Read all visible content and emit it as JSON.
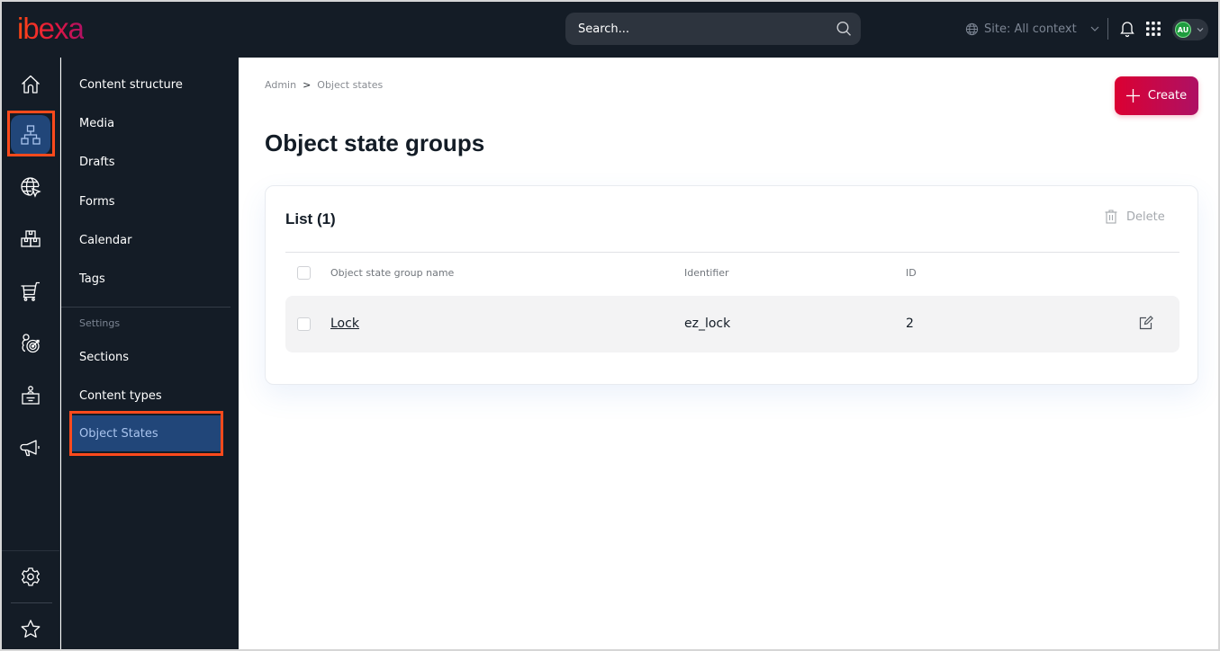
{
  "app": {
    "logo_text": "ibexa"
  },
  "topbar": {
    "search_placeholder": "Search...",
    "site_context_label": "Site: All context",
    "user_initials": "AU"
  },
  "rail": {
    "items": [
      {
        "id": "dashboard",
        "icon": "home-icon",
        "active": false
      },
      {
        "id": "content",
        "icon": "sitemap-icon",
        "active": true
      },
      {
        "id": "site",
        "icon": "globe-cursor-icon",
        "active": false
      },
      {
        "id": "product-catalog",
        "icon": "boxes-icon",
        "active": false
      },
      {
        "id": "commerce",
        "icon": "cart-icon",
        "active": false
      },
      {
        "id": "personalization",
        "icon": "user-target-icon",
        "active": false
      },
      {
        "id": "customer-portal",
        "icon": "badge-icon",
        "active": false
      },
      {
        "id": "marketing",
        "icon": "megaphone-icon",
        "active": false
      }
    ],
    "bottom_items": [
      {
        "id": "admin",
        "icon": "gear-icon"
      },
      {
        "id": "bookmarks",
        "icon": "star-icon"
      }
    ]
  },
  "submenu": {
    "items": [
      {
        "label": "Content structure"
      },
      {
        "label": "Media"
      },
      {
        "label": "Drafts"
      },
      {
        "label": "Forms"
      },
      {
        "label": "Calendar"
      },
      {
        "label": "Tags"
      }
    ],
    "settings_heading": "Settings",
    "settings_items": [
      {
        "label": "Sections",
        "active": false
      },
      {
        "label": "Content types",
        "active": false
      },
      {
        "label": "Object States",
        "active": true
      }
    ]
  },
  "breadcrumb": {
    "items": [
      "Admin",
      "Object states"
    ],
    "separator": ">"
  },
  "page": {
    "title": "Object state groups",
    "create_label": "Create"
  },
  "list": {
    "title": "List (1)",
    "delete_label": "Delete",
    "columns": [
      "Object state group name",
      "Identifier",
      "ID"
    ],
    "rows": [
      {
        "name": "Lock",
        "identifier": "ez_lock",
        "id": "2"
      }
    ]
  },
  "colors": {
    "topbar_bg": "#141c26",
    "active_item_bg": "#214679",
    "highlight_outline": "#ff4a1c",
    "create_gradient_start": "#db0032",
    "create_gradient_end": "#ae1164"
  }
}
